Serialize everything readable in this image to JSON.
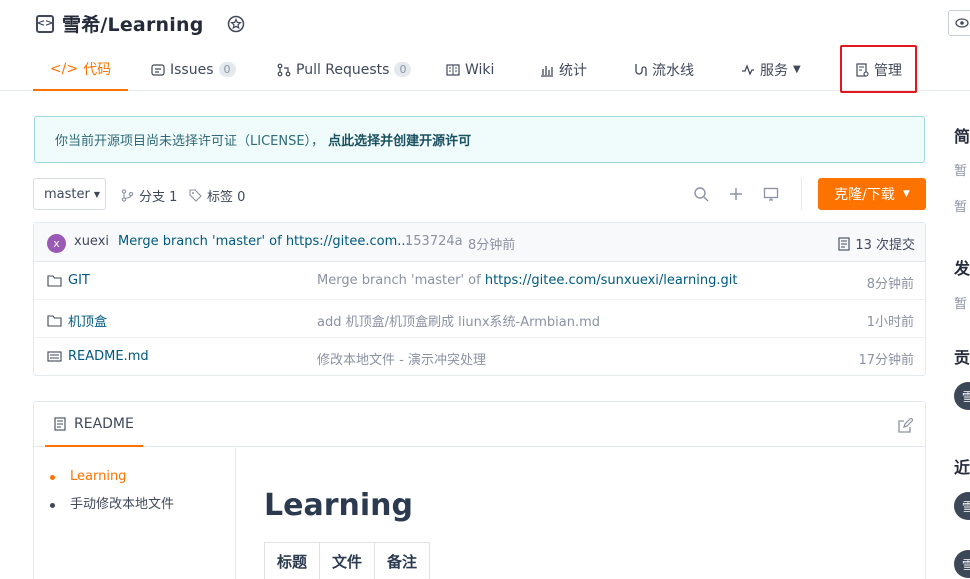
{
  "repo": {
    "title": "雪希/Learning",
    "icon": "code-repo-icon"
  },
  "tabs": [
    {
      "label": "代码",
      "icon": "</>",
      "active": true
    },
    {
      "label": "Issues",
      "count": "0"
    },
    {
      "label": "Pull Requests",
      "count": "0"
    },
    {
      "label": "Wiki"
    },
    {
      "label": "统计"
    },
    {
      "label": "流水线"
    },
    {
      "label": "服务",
      "has_dropdown": true
    },
    {
      "label": "管理"
    }
  ],
  "notice": {
    "text": "你当前开源项目尚未选择许可证（LICENSE），",
    "link": "点此选择并创建开源许可"
  },
  "toolbar": {
    "branch": "master",
    "branches": "分支 1",
    "tags": "标签 0",
    "clone_label": "克隆/下载"
  },
  "commit": {
    "avatar_letter": "x",
    "author": "xuexi",
    "message": "Merge branch 'master' of https://gitee.com...",
    "hash": "153724a",
    "time": "8分钟前",
    "count_label": "13 次提交"
  },
  "files": [
    {
      "name": "GIT",
      "type": "folder",
      "commit_prefix": "Merge branch 'master' of ",
      "commit_link": "https://gitee.com/sunxuexi/learning.git",
      "time": "8分钟前"
    },
    {
      "name": "机顶盒",
      "type": "folder",
      "commit_prefix": "add 机顶盒/机顶盒刷成 liunx系统-Armbian.md",
      "commit_link": "",
      "time": "1小时前"
    },
    {
      "name": "README.md",
      "type": "file",
      "commit_prefix": "修改本地文件 - 演示冲突处理",
      "commit_link": "",
      "time": "17分钟前"
    }
  ],
  "readme": {
    "tab_label": "README",
    "toc": [
      {
        "label": "Learning",
        "active": true
      },
      {
        "label": "手动修改本地文件",
        "active": false
      }
    ],
    "heading": "Learning",
    "table_headers": [
      "标题",
      "文件",
      "备注"
    ]
  },
  "sidebar": {
    "h1": "简",
    "t1": "暂",
    "t2": "暂",
    "h2": "发",
    "t3": "暂",
    "h3": "贡",
    "av1": "雪",
    "h4": "近",
    "av2": "雪",
    "av3": "雪"
  },
  "colors": {
    "accent": "#fe7300",
    "highlight": "#e5161c",
    "link": "#005980"
  }
}
